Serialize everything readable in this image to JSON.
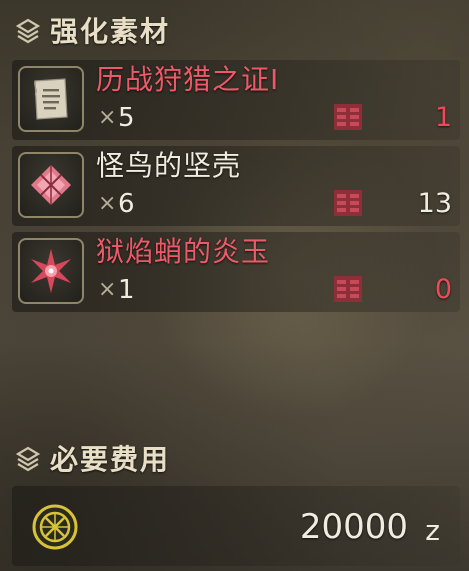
{
  "materials": {
    "title": "强化素材",
    "items": [
      {
        "name": "历战狩猎之证Ⅰ",
        "qty_prefix": "×",
        "qty": "5",
        "owned": "1",
        "icon": "scroll-icon",
        "status": "insufficient"
      },
      {
        "name": "怪鸟的坚壳",
        "qty_prefix": "×",
        "qty": "6",
        "owned": "13",
        "icon": "shell-icon",
        "status": "sufficient"
      },
      {
        "name": "狱焰蛸的炎玉",
        "qty_prefix": "×",
        "qty": "1",
        "owned": "0",
        "icon": "flame-gem-icon",
        "status": "insufficient"
      }
    ]
  },
  "cost": {
    "title": "必要费用",
    "value": "20000",
    "unit": "z",
    "icon": "zenny-coin-icon"
  },
  "colors": {
    "insufficient": "#ec5a6a",
    "sufficient": "#f0ece0",
    "header": "#e8dfc6",
    "coin": "#d8c238"
  }
}
